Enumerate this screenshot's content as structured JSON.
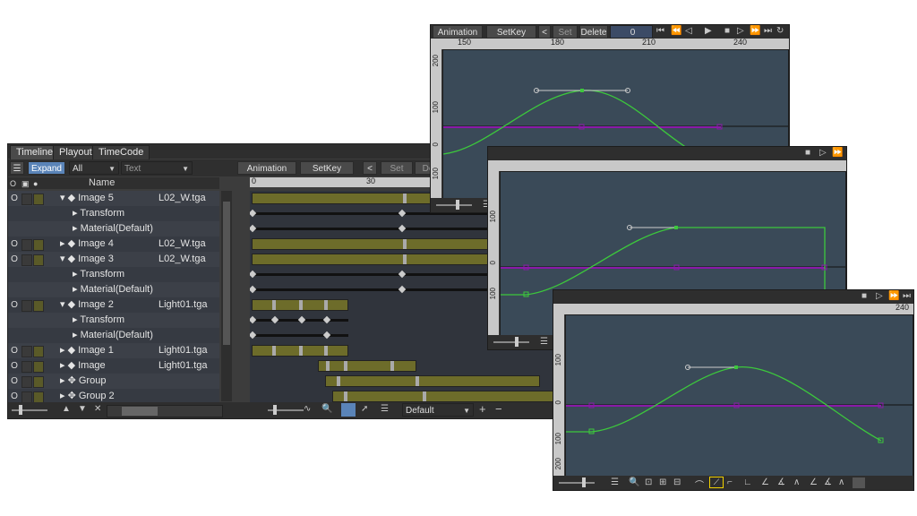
{
  "timeline": {
    "tabs": [
      "Timeline",
      "Playout",
      "TimeCode"
    ],
    "expand_label": "Expand",
    "filter_value": "All",
    "text_placeholder": "Text",
    "column_name": "Name",
    "animation_label": "Animation",
    "setkey_label": "SetKey",
    "set_label": "Set",
    "delete_partial": "De",
    "ruler": [
      "0",
      "30"
    ],
    "preset_value": "Default",
    "rows": [
      {
        "name": "Image 5",
        "file": "L02_W.tga",
        "level": 0,
        "expanded": true,
        "layer": true
      },
      {
        "name": "Transform",
        "file": "",
        "level": 1,
        "expanded": false,
        "layer": false
      },
      {
        "name": "Material(Default)",
        "file": "",
        "level": 1,
        "expanded": false,
        "layer": false
      },
      {
        "name": "Image 4",
        "file": "L02_W.tga",
        "level": 0,
        "expanded": false,
        "layer": true
      },
      {
        "name": "Image 3",
        "file": "L02_W.tga",
        "level": 0,
        "expanded": true,
        "layer": true
      },
      {
        "name": "Transform",
        "file": "",
        "level": 1,
        "expanded": false,
        "layer": false
      },
      {
        "name": "Material(Default)",
        "file": "",
        "level": 1,
        "expanded": false,
        "layer": false
      },
      {
        "name": "Image 2",
        "file": "Light01.tga",
        "level": 0,
        "expanded": true,
        "layer": true
      },
      {
        "name": "Transform",
        "file": "",
        "level": 1,
        "expanded": false,
        "layer": false
      },
      {
        "name": "Material(Default)",
        "file": "",
        "level": 1,
        "expanded": false,
        "layer": false
      },
      {
        "name": "Image 1",
        "file": "Light01.tga",
        "level": 0,
        "expanded": false,
        "layer": true
      },
      {
        "name": "Image",
        "file": "Light01.tga",
        "level": 0,
        "expanded": false,
        "layer": true
      },
      {
        "name": "Group",
        "file": "",
        "level": 0,
        "expanded": false,
        "layer": true
      },
      {
        "name": "Group 2",
        "file": "",
        "level": 0,
        "expanded": false,
        "layer": true
      }
    ]
  },
  "graph_top": {
    "animation_label": "Animation",
    "setkey_label": "SetKey",
    "set_label": "Set",
    "delete_label": "Delete",
    "frame_value": "0",
    "ruler": [
      "150",
      "180",
      "210",
      "240"
    ],
    "v_ruler": [
      "200",
      "100",
      "0",
      "100"
    ]
  },
  "graph_mid": {
    "v_ruler": [
      "100",
      "0",
      "100"
    ]
  },
  "graph_bottom": {
    "ruler": [
      "240"
    ],
    "v_ruler": [
      "100",
      "0",
      "100",
      "200"
    ]
  },
  "colors": {
    "curve": "#3cc83c",
    "baseline": "#8a1aa8",
    "bar": "#6d6c2a",
    "highlight": "#f0d000",
    "expand_button": "#5a84b8"
  }
}
